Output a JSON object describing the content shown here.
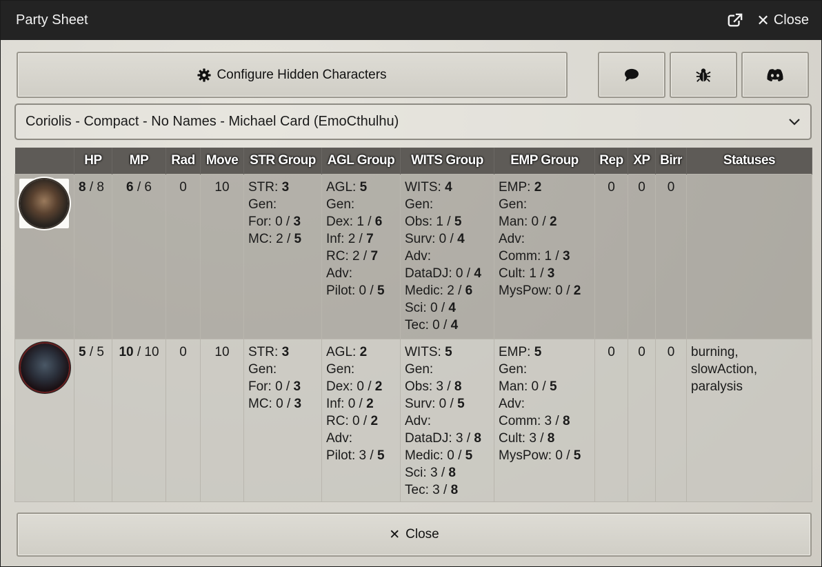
{
  "window": {
    "title": "Party Sheet",
    "close_label": "Close"
  },
  "icons": {
    "popout": "external-link-icon",
    "close": "close-icon",
    "gear": "gear-icon",
    "chat": "chat-bubble-icon",
    "bug": "bug-icon",
    "discord": "discord-icon",
    "chevron": "chevron-down-icon"
  },
  "toolbar": {
    "configure_label": "Configure Hidden Characters"
  },
  "layout_select": {
    "selected": "Coriolis - Compact - No Names - Michael Card (EmoCthulhu)"
  },
  "table": {
    "headers": [
      "",
      "HP",
      "MP",
      "Rad",
      "Move",
      "STR Group",
      "AGL Group",
      "WITS Group",
      "EMP Group",
      "Rep",
      "XP",
      "Birr",
      "Statuses"
    ],
    "rows": [
      {
        "hp": "8",
        "hp_max": "8",
        "mp": "6",
        "mp_max": "6",
        "rad": "0",
        "move": "10",
        "str": "3",
        "str_for": "0",
        "str_for_max": "3",
        "str_mc": "2",
        "str_mc_max": "5",
        "agl": "5",
        "agl_dex": "1",
        "agl_dex_max": "6",
        "agl_inf": "2",
        "agl_inf_max": "7",
        "agl_rc": "2",
        "agl_rc_max": "7",
        "agl_pilot": "0",
        "agl_pilot_max": "5",
        "wits": "4",
        "wits_obs": "1",
        "wits_obs_max": "5",
        "wits_surv": "0",
        "wits_surv_max": "4",
        "wits_datadj": "0",
        "wits_datadj_max": "4",
        "wits_medic": "2",
        "wits_medic_max": "6",
        "wits_sci": "0",
        "wits_sci_max": "4",
        "wits_tec": "0",
        "wits_tec_max": "4",
        "emp": "2",
        "emp_man": "0",
        "emp_man_max": "2",
        "emp_comm": "1",
        "emp_comm_max": "3",
        "emp_cult": "1",
        "emp_cult_max": "3",
        "emp_myspow": "0",
        "emp_myspow_max": "2",
        "rep": "0",
        "xp": "0",
        "birr": "0",
        "statuses": ""
      },
      {
        "hp": "5",
        "hp_max": "5",
        "mp": "10",
        "mp_max": "10",
        "rad": "0",
        "move": "10",
        "str": "3",
        "str_for": "0",
        "str_for_max": "3",
        "str_mc": "0",
        "str_mc_max": "3",
        "agl": "2",
        "agl_dex": "0",
        "agl_dex_max": "2",
        "agl_inf": "0",
        "agl_inf_max": "2",
        "agl_rc": "0",
        "agl_rc_max": "2",
        "agl_pilot": "3",
        "agl_pilot_max": "5",
        "wits": "5",
        "wits_obs": "3",
        "wits_obs_max": "8",
        "wits_surv": "0",
        "wits_surv_max": "5",
        "wits_datadj": "3",
        "wits_datadj_max": "8",
        "wits_medic": "0",
        "wits_medic_max": "5",
        "wits_sci": "3",
        "wits_sci_max": "8",
        "wits_tec": "3",
        "wits_tec_max": "8",
        "emp": "5",
        "emp_man": "0",
        "emp_man_max": "5",
        "emp_comm": "3",
        "emp_comm_max": "8",
        "emp_cult": "3",
        "emp_cult_max": "8",
        "emp_myspow": "0",
        "emp_myspow_max": "5",
        "rep": "0",
        "xp": "0",
        "birr": "0",
        "statuses": "burning, slowAction, paralysis"
      }
    ]
  },
  "labels": {
    "str": "STR:",
    "agl": "AGL:",
    "wits": "WITS:",
    "emp": "EMP:",
    "gen": "Gen:",
    "adv": "Adv:",
    "for": "For:",
    "mc": "MC:",
    "dex": "Dex:",
    "inf": "Inf:",
    "rc": "RC:",
    "pilot": "Pilot:",
    "obs": "Obs:",
    "surv": "Surv:",
    "datadj": "DataDJ:",
    "medic": "Medic:",
    "sci": "Sci:",
    "tec": "Tec:",
    "man": "Man:",
    "comm": "Comm:",
    "cult": "Cult:",
    "myspow": "MysPow:",
    "sep": " / "
  },
  "footer": {
    "close_label": "Close"
  }
}
